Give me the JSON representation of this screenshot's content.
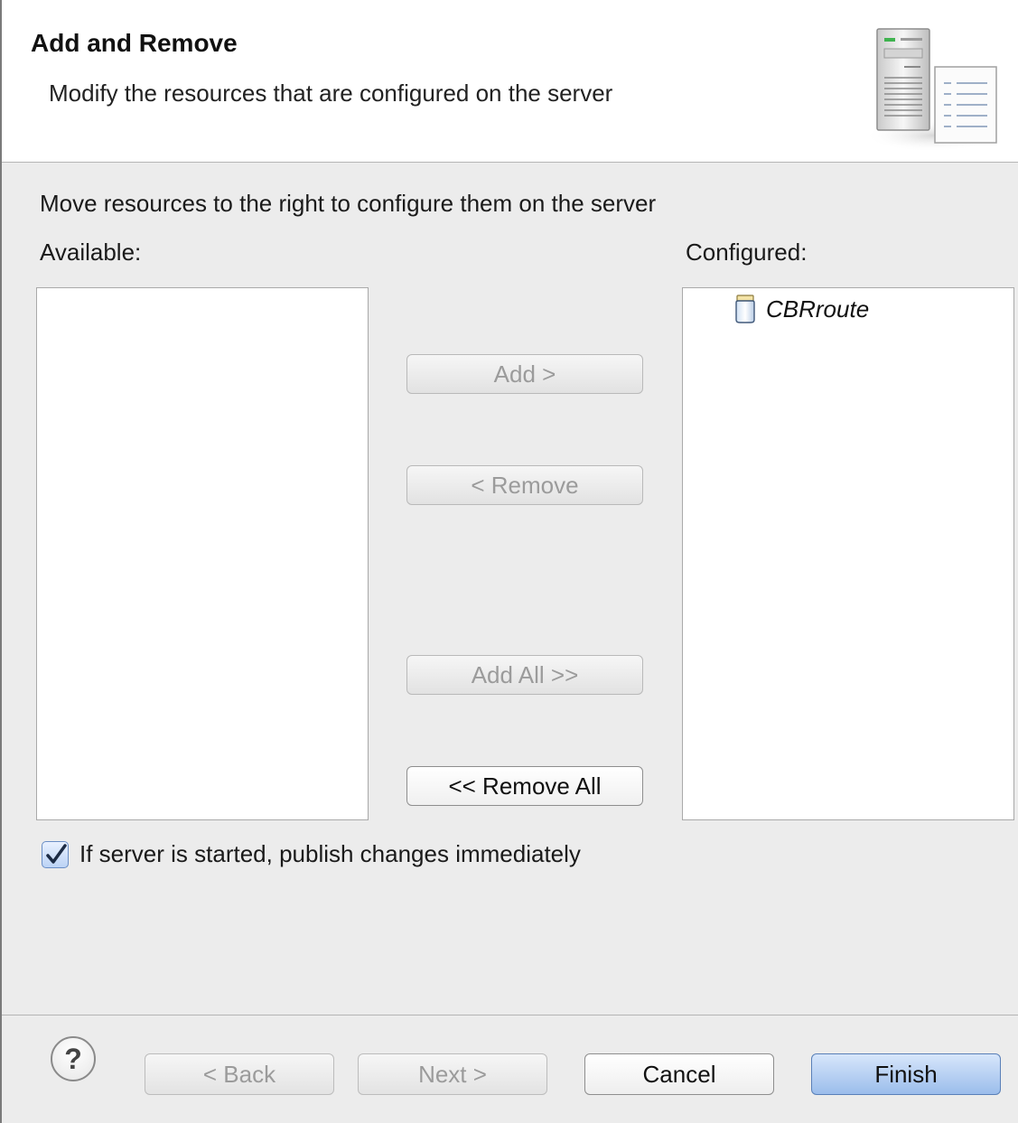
{
  "header": {
    "title": "Add and Remove",
    "description": "Modify the resources that are configured on the server"
  },
  "main": {
    "instruction": "Move resources to the right to configure them on the server",
    "available_label": "Available:",
    "configured_label": "Configured:",
    "available_items": [],
    "configured_items": [
      {
        "label": "CBRroute",
        "icon": "jar-icon"
      }
    ],
    "buttons": {
      "add": "Add >",
      "remove": "< Remove",
      "add_all": "Add All >>",
      "remove_all": "<< Remove All"
    },
    "publish_checkbox": {
      "label": "If server is started, publish changes immediately",
      "checked": true
    }
  },
  "footer": {
    "help": "?",
    "back": "< Back",
    "next": "Next >",
    "cancel": "Cancel",
    "finish": "Finish"
  },
  "colors": {
    "accent": "#9bbdeb",
    "disabled_text": "#9b9b9b"
  }
}
